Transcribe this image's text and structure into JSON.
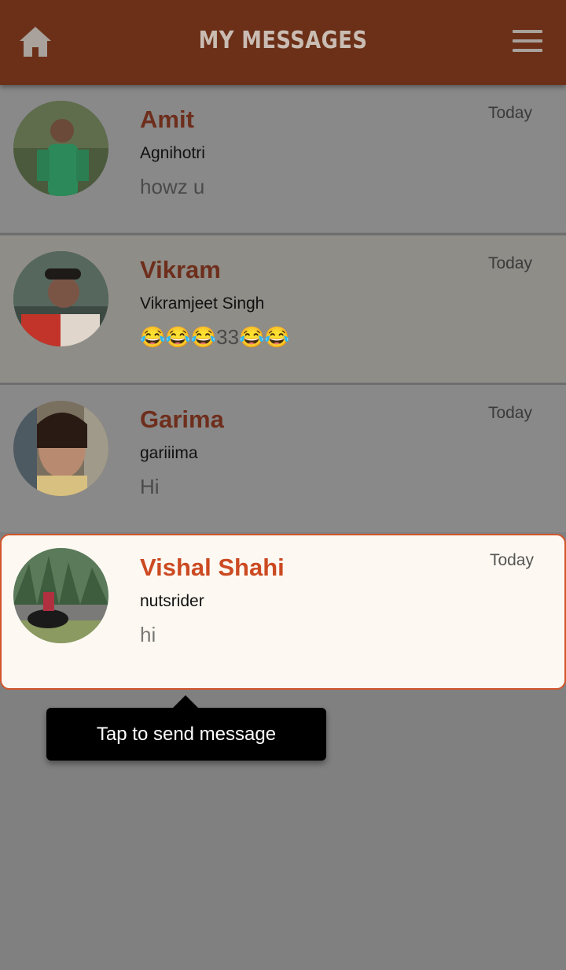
{
  "header": {
    "title": "MY MESSAGES",
    "home_icon": "home-icon",
    "menu_icon": "menu-icon"
  },
  "conversations": [
    {
      "name": "Amit",
      "username": "Agnihotri",
      "message": "howz u",
      "time": "Today"
    },
    {
      "name": "Vikram",
      "username": "Vikramjeet Singh",
      "message": "😂😂😂33😂😂",
      "time": "Today"
    },
    {
      "name": "Garima",
      "username": "gariiima",
      "message": "Hi",
      "time": "Today"
    },
    {
      "name": "Vishal Shahi",
      "username": "nutsrider",
      "message": "hi",
      "time": "Today"
    }
  ],
  "tooltip": {
    "text": "Tap to send message"
  },
  "colors": {
    "header": "#6c3018",
    "accent": "#cc4a22",
    "highlight_bg": "#fdf9f2"
  }
}
